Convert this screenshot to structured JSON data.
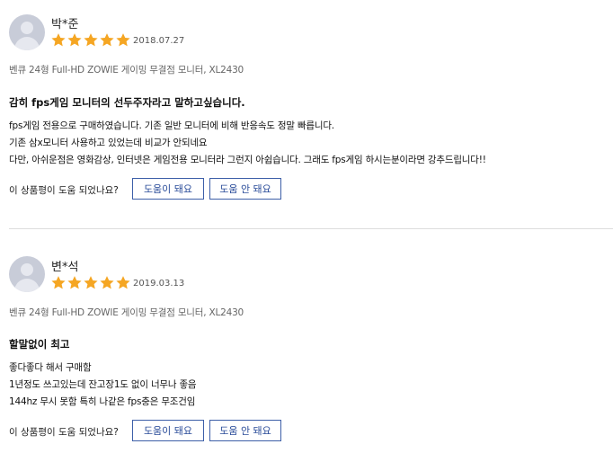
{
  "reviews": [
    {
      "name": "박*준",
      "rating": 5,
      "date": "2018.07.27",
      "product": "벤큐 24형 Full-HD ZOWIE 게이밍 무결점 모니터, XL2430",
      "title": "감히 fps게임 모니터의 선두주자라고 말하고싶습니다.",
      "lines": [
        "fps게임 전용으로 구매하였습니다. 기존 일반 모니터에 비해 반응속도 정말 빠릅니다.",
        "기존 삼x모니터 사용하고 있었는데 비교가 안되네요",
        "다만, 아쉬운점은 영화감상, 인터넷은 게임전용 모니터라 그런지 아쉽습니다. 그래도 fps게임 하시는분이라면 강추드립니다!!"
      ],
      "helpful_question": "이 상품평이 도움 되었나요?",
      "helpful_yes": "도움이 돼요",
      "helpful_no": "도움 안 돼요"
    },
    {
      "name": "변*석",
      "rating": 5,
      "date": "2019.03.13",
      "product": "벤큐 24형 Full-HD ZOWIE 게이밍 무결점 모니터, XL2430",
      "title": "할말없이 최고",
      "lines": [
        "좋다좋다 해서 구매함",
        "1년정도 쓰고있는데 잔고장1도 없이 너무나 좋음",
        "144hz 무시 못함 특히 나같은 fps충은 무조건임"
      ],
      "helpful_question": "이 상품평이 도움 되었나요?",
      "helpful_yes": "도움이 돼요",
      "helpful_no": "도움 안 돼요"
    }
  ],
  "colors": {
    "star": "#f5a623",
    "button_border": "#3d5fa8",
    "button_text": "#2b4d9a"
  }
}
